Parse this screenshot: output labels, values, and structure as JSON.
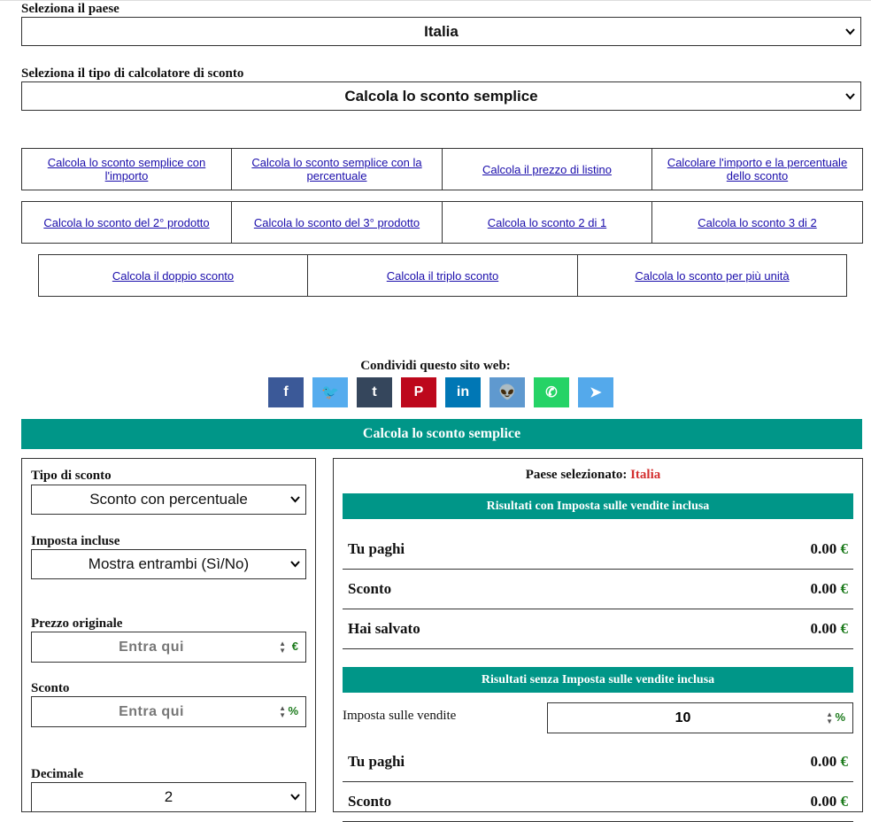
{
  "country": {
    "label": "Seleziona il paese",
    "value": "Italia"
  },
  "calc_type": {
    "label": "Seleziona il tipo di calcolatore di sconto",
    "value": "Calcola lo sconto semplice"
  },
  "links_row1": [
    "Calcola lo sconto semplice con l'importo",
    "Calcola lo sconto semplice con la percentuale",
    "Calcola il prezzo di listino",
    "Calcolare l'importo e la percentuale dello sconto"
  ],
  "links_row2": [
    "Calcola lo sconto del 2° prodotto",
    "Calcola lo sconto del 3° prodotto",
    "Calcola lo sconto 2 di 1",
    "Calcola lo sconto 3 di 2"
  ],
  "links_row3": [
    "Calcola il doppio sconto",
    "Calcola il triplo sconto",
    "Calcola lo sconto per più unità"
  ],
  "share": {
    "title": "Condividi questo sito web:",
    "buttons": [
      {
        "icon": "facebook-icon",
        "glyph": "f",
        "color": "#3b5998"
      },
      {
        "icon": "twitter-icon",
        "glyph": "🐦",
        "color": "#55acee"
      },
      {
        "icon": "tumblr-icon",
        "glyph": "t",
        "color": "#35465c"
      },
      {
        "icon": "pinterest-icon",
        "glyph": "P",
        "color": "#bd081c"
      },
      {
        "icon": "linkedin-icon",
        "glyph": "in",
        "color": "#0077b5"
      },
      {
        "icon": "reddit-icon",
        "glyph": "👽",
        "color": "#5f99cf"
      },
      {
        "icon": "whatsapp-icon",
        "glyph": "✆",
        "color": "#25d366"
      },
      {
        "icon": "telegram-icon",
        "glyph": "➤",
        "color": "#54a9eb"
      }
    ]
  },
  "banner": "Calcola lo sconto semplice",
  "form": {
    "tipo_label": "Tipo di sconto",
    "tipo_value": "Sconto con percentuale",
    "imposta_label": "Imposta incluse",
    "imposta_value": "Mostra entrambi (Sì/No)",
    "prezzo_label": "Prezzo originale",
    "prezzo_placeholder": "Entra qui",
    "prezzo_unit": "€",
    "sconto_label": "Sconto",
    "sconto_placeholder": "Entra qui",
    "sconto_unit": "%",
    "decimale_label": "Decimale",
    "decimale_value": "2"
  },
  "results": {
    "country_label": "Paese selezionato:",
    "country_value": "Italia",
    "with_tax_title": "Risultati con Imposta sulle vendite inclusa",
    "with_tax": [
      {
        "label": "Tu paghi",
        "value": "0.00",
        "cur": "€"
      },
      {
        "label": "Sconto",
        "value": "0.00",
        "cur": "€"
      },
      {
        "label": "Hai salvato",
        "value": "0.00",
        "cur": "€"
      }
    ],
    "without_tax_title": "Risultati senza Imposta sulle vendite inclusa",
    "tax_label": "Imposta sulle vendite",
    "tax_value": "10",
    "tax_unit": "%",
    "without_tax": [
      {
        "label": "Tu paghi",
        "value": "0.00",
        "cur": "€"
      },
      {
        "label": "Sconto",
        "value": "0.00",
        "cur": "€"
      }
    ]
  }
}
